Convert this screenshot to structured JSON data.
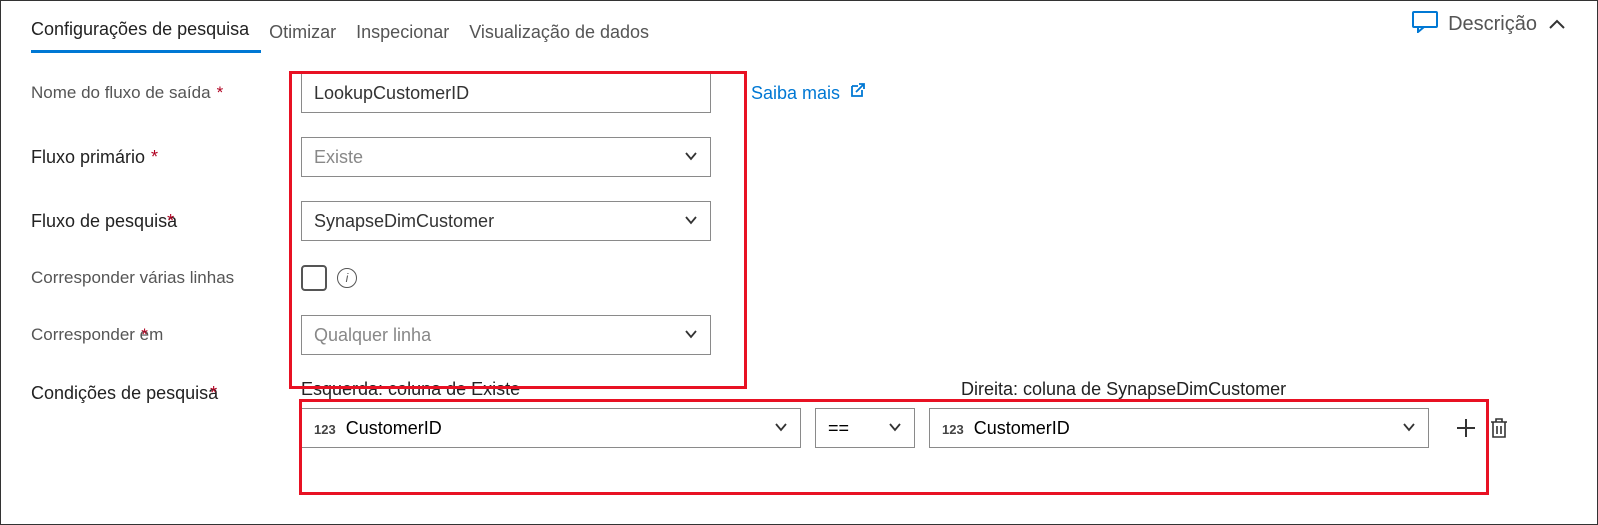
{
  "tabs": {
    "settings": "Configurações de pesquisa",
    "optimize": "Otimizar",
    "inspect": "Inspecionar",
    "dataPreview": "Visualização de dados"
  },
  "header": {
    "descriptionLabel": "Descrição"
  },
  "form": {
    "outputStreamLabel": "Nome do fluxo de saída",
    "outputStreamValue": "LookupCustomerID",
    "learnMore": "Saiba mais",
    "primaryStreamLabel": "Fluxo primário",
    "primaryStreamValue": "Existe",
    "lookupStreamLabel": "Fluxo de pesquisa",
    "lookupStreamLabelMark": "*",
    "lookupStreamValue": "SynapseDimCustomer",
    "matchMultipleLabel": "Corresponder várias linhas",
    "matchOnLabel": "Corresponder em",
    "matchOnLabelMark": "*",
    "matchOnValue": "Qualquer linha",
    "conditionsLabel": "Condições de pesquisa",
    "conditionsLabelMark": "*"
  },
  "conditions": {
    "leftHeader": "Esquerda: coluna de Existe",
    "rightHeader": "Direita: coluna de SynapseDimCustomer",
    "leftColType": "123",
    "leftColName": "CustomerID",
    "operator": "==",
    "rightColType": "123",
    "rightColName": "CustomerID"
  }
}
